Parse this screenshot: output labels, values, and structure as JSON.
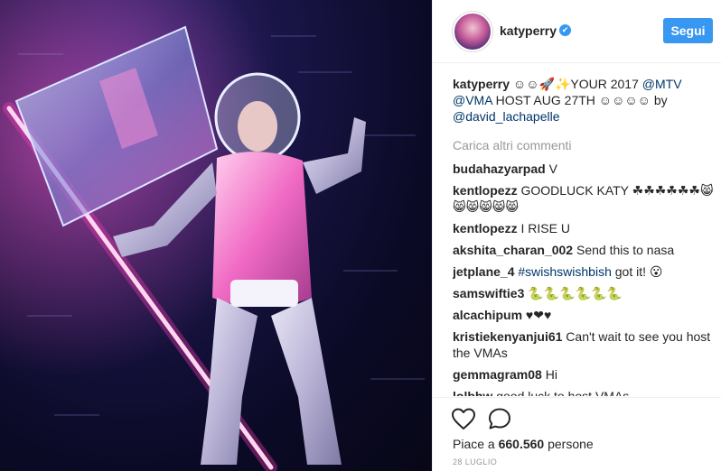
{
  "post": {
    "username": "katyperry",
    "verified_badge": "✔",
    "follow_label": "Segui",
    "caption": {
      "user": "katyperry",
      "text_before": " ☺☺🚀✨YOUR 2017 ",
      "mention1": "@MTV",
      "space": " ",
      "mention2": "@VMA",
      "text_after": " HOST AUG 27TH ☺☺☺☺ by ",
      "mention3": "@david_lachapelle"
    },
    "load_more": "Carica altri commenti",
    "comments": [
      {
        "user": "budahazyarpad",
        "text": " V"
      },
      {
        "user": "kentlopezz",
        "text": " GOODLUCK KATY ☘☘☘☘☘☘😸😸😸😸😸😸"
      },
      {
        "user": "kentlopezz",
        "text": " I RISE U"
      },
      {
        "user": "akshita_charan_002",
        "text": " Send this to nasa"
      },
      {
        "user": "jetplane_4",
        "pre": " ",
        "tag": "#swishswishbish",
        "text": " got it! 😮"
      },
      {
        "user": "samswiftie3",
        "text": " 🐍🐍🐍🐍🐍🐍"
      },
      {
        "user": "alcachipum",
        "text": " ♥❤♥"
      },
      {
        "user": "kristiekenyanjui61",
        "text": " Can't wait to see you host the VMAs"
      },
      {
        "user": "gemmagram08",
        "text": " Hi"
      },
      {
        "user": "lolbhw",
        "text": " good luck to host VMAs"
      }
    ],
    "likes_prefix": "Piace a ",
    "likes_count": "660.560",
    "likes_suffix": " persone",
    "date": "28 LUGLIO",
    "icons": {
      "like": "heart-icon",
      "comment": "comment-icon",
      "verified": "verified-icon"
    },
    "colors": {
      "accent": "#3897f0",
      "link": "#003569",
      "muted": "#999999"
    }
  }
}
